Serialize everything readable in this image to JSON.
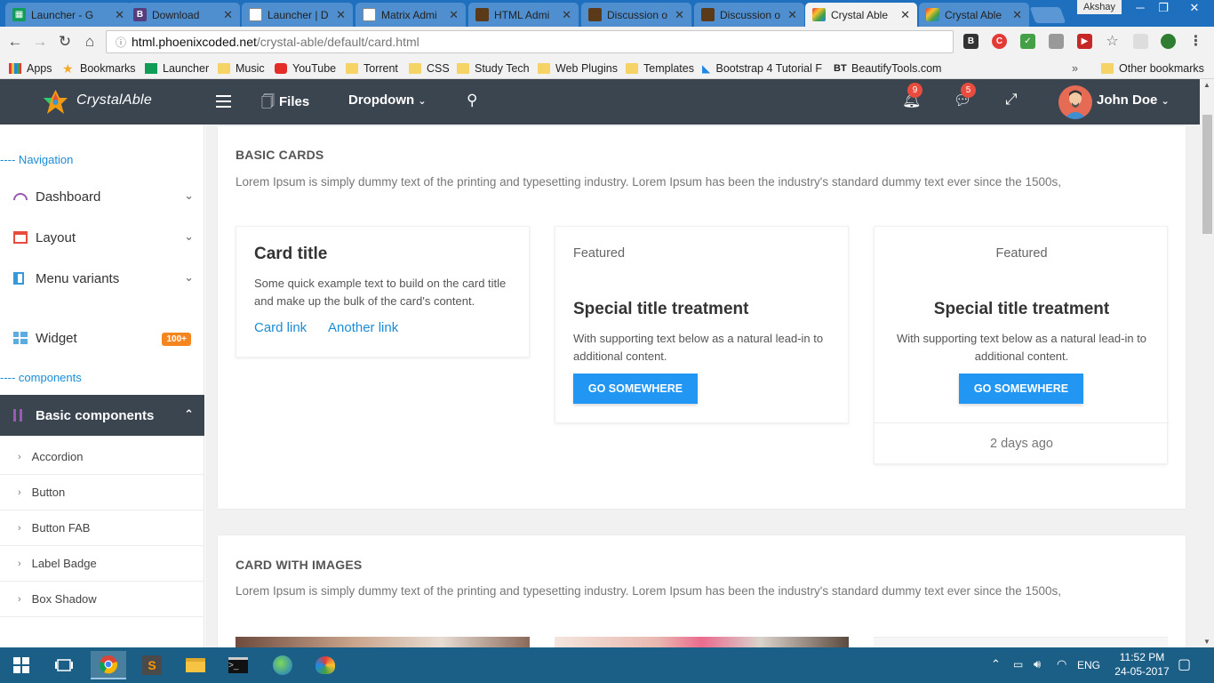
{
  "browser": {
    "tabs": [
      {
        "title": "Launcher - G",
        "favicon": "sheets-icon",
        "active": false
      },
      {
        "title": "Download",
        "favicon": "bootstrap-icon",
        "active": false
      },
      {
        "title": "Launcher | D",
        "favicon": "doc-icon",
        "active": false
      },
      {
        "title": "Matrix Admi",
        "favicon": "doc-icon",
        "active": false
      },
      {
        "title": "HTML Admi",
        "favicon": "tf-icon",
        "active": false
      },
      {
        "title": "Discussion o",
        "favicon": "tf-icon",
        "active": false
      },
      {
        "title": "Discussion o",
        "favicon": "tf-icon",
        "active": false
      },
      {
        "title": "Crystal Able",
        "favicon": "crystal-icon",
        "active": true
      },
      {
        "title": "Crystal Able",
        "favicon": "crystal-icon",
        "active": false
      }
    ],
    "profile_name": "Akshay",
    "url_host": "html.phoenixcoded.net",
    "url_path": "/crystal-able/default/card.html",
    "bookmarks": [
      {
        "label": "Apps",
        "icon": "apps-icon"
      },
      {
        "label": "Bookmarks",
        "icon": "star-icon"
      },
      {
        "label": "Launcher",
        "icon": "sheets-icon"
      },
      {
        "label": "Music",
        "icon": "folder-icon"
      },
      {
        "label": "YouTube",
        "icon": "youtube-icon"
      },
      {
        "label": "Torrent",
        "icon": "folder-icon"
      },
      {
        "label": "CSS",
        "icon": "folder-icon"
      },
      {
        "label": "Study Tech",
        "icon": "folder-icon"
      },
      {
        "label": "Web Plugins",
        "icon": "folder-icon"
      },
      {
        "label": "Templates",
        "icon": "folder-icon"
      },
      {
        "label": "Bootstrap 4 Tutorial F",
        "icon": "bootstrap-tutorial-icon"
      },
      {
        "label": "BeautifyTools.com",
        "icon": "bt-icon"
      }
    ],
    "other_bookmarks": "Other bookmarks"
  },
  "app": {
    "brand": "CrystalAble",
    "files_label": "Files",
    "dropdown_label": "Dropdown",
    "notifications_count": "9",
    "messages_count": "5",
    "user_name": "John Doe"
  },
  "sidebar": {
    "navigation_label": "---- Navigation",
    "menu": [
      {
        "label": "Dashboard"
      },
      {
        "label": "Layout"
      },
      {
        "label": "Menu variants"
      }
    ],
    "widget_label": "Widget",
    "widget_badge": "100+",
    "components_label": "---- components",
    "active_label": "Basic components",
    "submenu": [
      {
        "label": "Accordion"
      },
      {
        "label": "Button"
      },
      {
        "label": "Button FAB"
      },
      {
        "label": "Label Badge"
      },
      {
        "label": "Box Shadow"
      }
    ]
  },
  "main": {
    "basic": {
      "title": "BASIC CARDS",
      "desc": "Lorem Ipsum is simply dummy text of the printing and typesetting industry. Lorem Ipsum has been the industry's standard dummy text ever since the 1500s,"
    },
    "card1": {
      "title": "Card title",
      "text": "Some quick example text to build on the card title and make up the bulk of the card's content.",
      "link1": "Card link",
      "link2": "Another link"
    },
    "card2": {
      "header": "Featured",
      "title": "Special title treatment",
      "text": "With supporting text below as a natural lead-in to additional content.",
      "button": "GO SOMEWHERE"
    },
    "card3": {
      "header": "Featured",
      "title": "Special title treatment",
      "text": "With supporting text below as a natural lead-in to additional content.",
      "button": "GO SOMEWHERE",
      "footer": "2 days ago"
    },
    "images": {
      "title": "CARD WITH IMAGES",
      "desc": "Lorem Ipsum is simply dummy text of the printing and typesetting industry. Lorem Ipsum has been the industry's standard dummy text ever since the 1500s,"
    }
  },
  "taskbar": {
    "language": "ENG",
    "time": "11:52 PM",
    "date": "24-05-2017"
  },
  "colors": {
    "header_bg": "#3b4550",
    "accent": "#2196f3",
    "link": "#1a8cd6",
    "badge": "#f5851f",
    "taskbar": "#1c5f86"
  }
}
